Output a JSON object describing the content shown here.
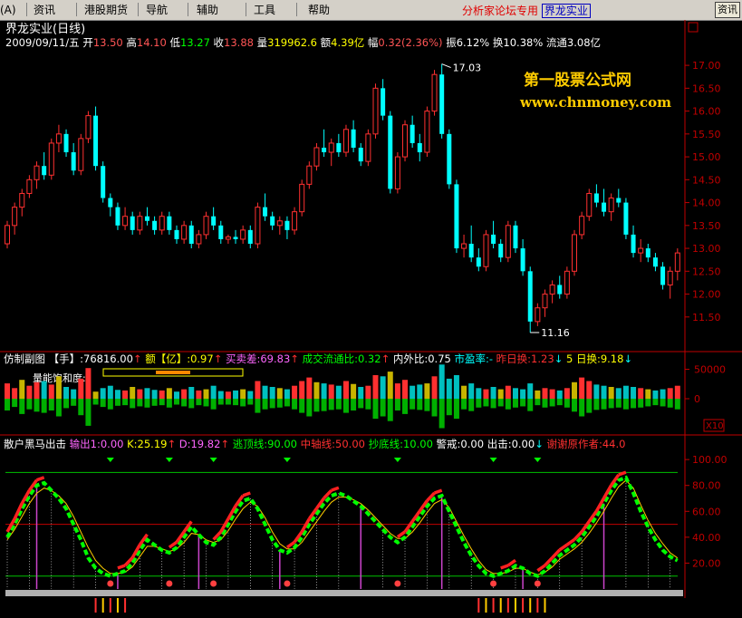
{
  "menu": {
    "items": [
      "(A)",
      "资讯",
      "港股期货",
      "导航",
      "辅助",
      "工具",
      "帮助"
    ],
    "announcement": "分析家论坛专用",
    "link": "界龙实业",
    "right_button": "资讯"
  },
  "main": {
    "title": "界龙实业(日线)",
    "date": "2009/09/11/五",
    "stats": [
      {
        "label": "开",
        "value": "13.50",
        "color": "#ff5555"
      },
      {
        "label": "高",
        "value": "14.10",
        "color": "#ff5555"
      },
      {
        "label": "低",
        "value": "13.27",
        "color": "#00ff00"
      },
      {
        "label": "收",
        "value": "13.88",
        "color": "#ff5555"
      },
      {
        "label": "量",
        "value": "319962.6",
        "color": "#ffff00"
      },
      {
        "label": "额",
        "value": "4.39亿",
        "color": "#ffff00"
      },
      {
        "label": "幅",
        "value": "0.32(2.36%)",
        "color": "#ff5555"
      },
      {
        "label": "振",
        "value": "6.12%",
        "color": "#ffffff"
      },
      {
        "label": "换",
        "value": "10.38%",
        "color": "#ffffff"
      },
      {
        "label": "流通",
        "value": "3.08亿",
        "color": "#ffffff"
      }
    ],
    "watermark1": "第一股票公式网",
    "watermark2": "www.chnmoney.com",
    "high_marker": "17.03",
    "low_marker": "11.16",
    "corner_box": "口"
  },
  "sub1": {
    "title": "仿制副图",
    "stats": [
      {
        "label": "【手】",
        "value": ":76816.00",
        "arrow": "↑",
        "color": "#ffffff",
        "arrow_color": "#ff3030"
      },
      {
        "label": "额【亿】",
        "value": ":0.97",
        "arrow": "↑",
        "color": "#ffff00",
        "arrow_color": "#ff3030"
      },
      {
        "label": "买卖差",
        "value": ":69.83",
        "arrow": "↑",
        "color": "#ff66ff",
        "arrow_color": "#ff3030"
      },
      {
        "label": "成交流通比",
        "value": ":0.32",
        "arrow": "↑",
        "color": "#00ff00",
        "arrow_color": "#ff3030"
      },
      {
        "label": "内外比",
        "value": ":0.75",
        "arrow": "",
        "color": "#ffffff",
        "arrow_color": "#ff3030"
      },
      {
        "label": "市盈率",
        "value": ":-",
        "arrow": "",
        "color": "#00ffff",
        "arrow_color": "#ff3030"
      },
      {
        "label": "昨日换",
        "value": ":1.23",
        "arrow": "↓",
        "color": "#ff3030",
        "arrow_color": "#00ffff"
      },
      {
        "label": "5 日换",
        "value": ":9.18",
        "arrow": "↓",
        "color": "#ffff00",
        "arrow_color": "#00ffff"
      }
    ],
    "label": "量能饱和度:",
    "x10": "X10"
  },
  "sub2": {
    "title": "散户黑马出击",
    "stats": [
      {
        "label": "输出",
        "value": "1:0.00",
        "arrow": "",
        "color": "#ff66ff",
        "arrow_color": "#ff3030"
      },
      {
        "label": "K",
        "value": ":25.19",
        "arrow": "↑",
        "color": "#ffff00",
        "arrow_color": "#ff3030"
      },
      {
        "label": "D",
        "value": ":19.82",
        "arrow": "↑",
        "color": "#ff66ff",
        "arrow_color": "#ff3030"
      },
      {
        "label": "逃顶线",
        "value": ":90.00",
        "arrow": "",
        "color": "#00ff00",
        "arrow_color": "#ff3030"
      },
      {
        "label": "中轴线",
        "value": ":50.00",
        "arrow": "",
        "color": "#ff3030",
        "arrow_color": "#ff3030"
      },
      {
        "label": "抄底线",
        "value": ":10.00",
        "arrow": "",
        "color": "#00ff00",
        "arrow_color": "#ff3030"
      },
      {
        "label": "警戒",
        "value": ":0.00",
        "arrow": "",
        "color": "#ffffff",
        "arrow_color": "#ff3030"
      },
      {
        "label": "出击",
        "value": ":0.00",
        "arrow": "↓",
        "color": "#ffffff",
        "arrow_color": "#00ffff"
      },
      {
        "label": "谢谢原作者",
        "value": ":44.0",
        "arrow": "",
        "color": "#ff3030",
        "arrow_color": "#ff3030"
      }
    ]
  },
  "chart_data": [
    {
      "type": "candlestick",
      "y_ticks": [
        "17.00",
        "16.50",
        "16.00",
        "15.50",
        "15.00",
        "14.50",
        "14.00",
        "13.50",
        "13.00",
        "12.50",
        "12.00",
        "11.50"
      ],
      "ylim": [
        11.1,
        17.2
      ],
      "colors": {
        "up": "#ff3030",
        "down": "#00ffff"
      },
      "ohlc": [
        [
          13.1,
          13.6,
          13.0,
          13.5
        ],
        [
          13.5,
          14.0,
          13.3,
          13.9
        ],
        [
          13.9,
          14.3,
          13.7,
          14.2
        ],
        [
          14.2,
          14.6,
          14.1,
          14.5
        ],
        [
          14.5,
          14.9,
          14.3,
          14.8
        ],
        [
          14.8,
          15.1,
          14.5,
          14.6
        ],
        [
          14.6,
          15.4,
          14.5,
          15.3
        ],
        [
          15.3,
          15.7,
          15.1,
          15.5
        ],
        [
          15.5,
          15.6,
          15.0,
          15.1
        ],
        [
          15.1,
          15.3,
          14.6,
          14.7
        ],
        [
          14.7,
          15.5,
          14.6,
          15.4
        ],
        [
          15.4,
          16.0,
          15.3,
          15.9
        ],
        [
          15.9,
          16.1,
          14.7,
          14.8
        ],
        [
          14.8,
          14.9,
          14.0,
          14.1
        ],
        [
          14.1,
          14.2,
          13.7,
          13.9
        ],
        [
          13.9,
          14.0,
          13.4,
          13.5
        ],
        [
          13.5,
          13.9,
          13.4,
          13.7
        ],
        [
          13.7,
          13.8,
          13.3,
          13.4
        ],
        [
          13.4,
          13.8,
          13.3,
          13.7
        ],
        [
          13.7,
          13.9,
          13.5,
          13.6
        ],
        [
          13.6,
          13.7,
          13.3,
          13.4
        ],
        [
          13.4,
          13.8,
          13.3,
          13.7
        ],
        [
          13.7,
          13.8,
          13.3,
          13.4
        ],
        [
          13.4,
          13.5,
          13.1,
          13.2
        ],
        [
          13.2,
          13.6,
          13.1,
          13.5
        ],
        [
          13.5,
          13.6,
          13.0,
          13.1
        ],
        [
          13.1,
          13.4,
          13.0,
          13.3
        ],
        [
          13.3,
          13.8,
          13.2,
          13.7
        ],
        [
          13.7,
          13.9,
          13.4,
          13.5
        ],
        [
          13.5,
          13.6,
          13.1,
          13.2
        ],
        [
          13.2,
          13.3,
          13.1,
          13.25
        ],
        [
          13.25,
          13.4,
          13.1,
          13.2
        ],
        [
          13.2,
          13.5,
          13.1,
          13.4
        ],
        [
          13.4,
          13.5,
          13.0,
          13.1
        ],
        [
          13.1,
          14.0,
          13.0,
          13.9
        ],
        [
          13.9,
          14.2,
          13.6,
          13.7
        ],
        [
          13.7,
          13.8,
          13.4,
          13.5
        ],
        [
          13.5,
          13.7,
          13.3,
          13.6
        ],
        [
          13.6,
          13.7,
          13.2,
          13.4
        ],
        [
          13.4,
          13.9,
          13.3,
          13.8
        ],
        [
          13.8,
          14.5,
          13.7,
          14.4
        ],
        [
          14.4,
          14.9,
          14.3,
          14.8
        ],
        [
          14.8,
          15.3,
          14.7,
          15.2
        ],
        [
          15.2,
          15.6,
          15.0,
          15.1
        ],
        [
          15.1,
          15.4,
          14.8,
          15.3
        ],
        [
          15.3,
          15.5,
          15.0,
          15.1
        ],
        [
          15.1,
          15.7,
          15.0,
          15.6
        ],
        [
          15.6,
          15.8,
          15.1,
          15.2
        ],
        [
          15.2,
          15.3,
          14.8,
          14.9
        ],
        [
          14.9,
          15.6,
          14.8,
          15.5
        ],
        [
          15.5,
          16.6,
          15.4,
          16.5
        ],
        [
          16.5,
          16.7,
          15.8,
          15.9
        ],
        [
          15.9,
          16.0,
          14.2,
          14.3
        ],
        [
          14.3,
          15.1,
          14.2,
          15.0
        ],
        [
          15.0,
          15.8,
          14.9,
          15.7
        ],
        [
          15.7,
          15.9,
          15.2,
          15.3
        ],
        [
          15.3,
          15.5,
          14.9,
          15.1
        ],
        [
          15.1,
          16.1,
          15.0,
          16.0
        ],
        [
          16.0,
          16.9,
          15.9,
          16.8
        ],
        [
          16.8,
          17.03,
          15.4,
          15.5
        ],
        [
          15.5,
          15.6,
          14.3,
          14.4
        ],
        [
          14.4,
          14.5,
          12.9,
          13.0
        ],
        [
          13.0,
          13.3,
          12.8,
          13.1
        ],
        [
          13.1,
          13.5,
          12.7,
          12.8
        ],
        [
          12.8,
          13.0,
          12.5,
          12.6
        ],
        [
          12.6,
          13.4,
          12.5,
          13.3
        ],
        [
          13.3,
          13.6,
          13.0,
          13.1
        ],
        [
          13.1,
          13.2,
          12.7,
          12.8
        ],
        [
          12.8,
          13.6,
          12.7,
          13.5
        ],
        [
          13.5,
          13.6,
          12.9,
          13.0
        ],
        [
          13.0,
          13.2,
          12.4,
          12.5
        ],
        [
          12.5,
          12.6,
          11.16,
          11.4
        ],
        [
          11.4,
          11.8,
          11.3,
          11.7
        ],
        [
          11.7,
          12.1,
          11.5,
          12.0
        ],
        [
          12.0,
          12.3,
          11.8,
          12.2
        ],
        [
          12.2,
          12.4,
          11.9,
          12.0
        ],
        [
          12.0,
          12.6,
          11.9,
          12.5
        ],
        [
          12.5,
          13.4,
          12.4,
          13.3
        ],
        [
          13.3,
          13.8,
          13.2,
          13.7
        ],
        [
          13.7,
          14.3,
          13.6,
          14.2
        ],
        [
          14.2,
          14.4,
          13.9,
          14.0
        ],
        [
          14.0,
          14.3,
          13.7,
          13.8
        ],
        [
          13.8,
          14.2,
          13.6,
          14.1
        ],
        [
          14.1,
          14.3,
          13.9,
          14.0
        ],
        [
          14.0,
          14.1,
          13.2,
          13.3
        ],
        [
          13.3,
          13.5,
          12.8,
          12.9
        ],
        [
          12.9,
          13.2,
          12.7,
          13.0
        ],
        [
          13.0,
          13.1,
          12.7,
          12.8
        ],
        [
          12.8,
          12.9,
          12.5,
          12.6
        ],
        [
          12.6,
          12.7,
          12.1,
          12.2
        ],
        [
          12.2,
          12.6,
          11.9,
          12.5
        ],
        [
          12.5,
          13.0,
          12.3,
          12.9
        ]
      ]
    },
    {
      "type": "bar",
      "y_ticks": [
        "50000",
        "0"
      ],
      "ylim": [
        -60000,
        60000
      ],
      "series": [
        {
          "values": [
            26000,
            18000,
            32000,
            22000,
            28000,
            30000,
            24000,
            38000,
            20000,
            16000,
            34000,
            52000,
            12000,
            18000,
            22000,
            15000,
            14000,
            20000,
            16000,
            18000,
            15000,
            14000,
            18000,
            12000,
            16000,
            20000,
            14000,
            16000,
            22000,
            13000,
            12000,
            14000,
            16000,
            13000,
            30000,
            22000,
            20000,
            18000,
            16000,
            22000,
            30000,
            36000,
            28000,
            26000,
            24000,
            22000,
            30000,
            25000,
            20000,
            22000,
            40000,
            38000,
            46000,
            26000,
            32000,
            22000,
            24000,
            26000,
            38000,
            58000,
            34000,
            40000,
            22000,
            26000,
            18000,
            16000,
            20000,
            16000,
            22000,
            18000,
            16000,
            26000,
            14000,
            18000,
            16000,
            14000,
            18000,
            28000,
            36000,
            30000,
            24000,
            22000,
            20000,
            18000,
            22000,
            20000,
            18000,
            16000,
            14000,
            16000,
            18000,
            22000
          ]
        },
        {
          "values": [
            -20000,
            -14000,
            -26000,
            -18000,
            -22000,
            -24000,
            -20000,
            -30000,
            -16000,
            -12000,
            -28000,
            -46000,
            -10000,
            -14000,
            -18000,
            -12000,
            -11000,
            -16000,
            -13000,
            -15000,
            -12000,
            -11000,
            -15000,
            -10000,
            -13000,
            -16000,
            -11000,
            -13000,
            -18000,
            -10000,
            -10000,
            -11000,
            -13000,
            -10000,
            -24000,
            -18000,
            -16000,
            -15000,
            -13000,
            -18000,
            -24000,
            -30000,
            -22000,
            -21000,
            -19000,
            -18000,
            -24000,
            -20000,
            -16000,
            -18000,
            -34000,
            -30000,
            -38000,
            -20000,
            -26000,
            -18000,
            -19000,
            -21000,
            -30000,
            -50000,
            -28000,
            -34000,
            -18000,
            -21000,
            -15000,
            -13000,
            -16000,
            -13000,
            -18000,
            -15000,
            -13000,
            -21000,
            -11000,
            -15000,
            -13000,
            -11000,
            -15000,
            -22000,
            -30000,
            -24000,
            -19000,
            -18000,
            -16000,
            -15000,
            -18000,
            -16000,
            -15000,
            -13000,
            -11000,
            -13000,
            -15000,
            -18000
          ]
        }
      ]
    },
    {
      "type": "line",
      "y_ticks": [
        "100.00",
        "80.00",
        "60.00",
        "40.00",
        "20.00"
      ],
      "ylim": [
        0,
        105
      ],
      "hlines": [
        90,
        50,
        10
      ],
      "series": [
        {
          "name": "K",
          "values": [
            40,
            50,
            62,
            72,
            80,
            82,
            76,
            70,
            62,
            50,
            38,
            24,
            16,
            12,
            10,
            12,
            14,
            20,
            30,
            38,
            34,
            30,
            28,
            32,
            40,
            48,
            42,
            36,
            34,
            40,
            50,
            60,
            68,
            70,
            62,
            50,
            38,
            30,
            28,
            32,
            40,
            50,
            58,
            66,
            72,
            74,
            72,
            68,
            64,
            58,
            52,
            46,
            40,
            36,
            40,
            48,
            56,
            64,
            70,
            72,
            60,
            48,
            36,
            26,
            18,
            12,
            10,
            12,
            14,
            18,
            16,
            12,
            10,
            14,
            20,
            26,
            30,
            34,
            40,
            48,
            56,
            66,
            76,
            84,
            86,
            74,
            60,
            48,
            38,
            30,
            25,
            22
          ]
        },
        {
          "name": "D",
          "values": [
            38,
            46,
            56,
            66,
            74,
            78,
            76,
            72,
            66,
            56,
            44,
            32,
            22,
            16,
            12,
            12,
            13,
            17,
            25,
            33,
            33,
            31,
            29,
            31,
            36,
            43,
            42,
            38,
            36,
            38,
            45,
            54,
            62,
            67,
            64,
            55,
            44,
            35,
            31,
            31,
            36,
            44,
            52,
            60,
            67,
            71,
            71,
            69,
            66,
            61,
            55,
            49,
            43,
            39,
            39,
            44,
            51,
            59,
            66,
            69,
            63,
            52,
            41,
            31,
            22,
            15,
            12,
            12,
            13,
            16,
            16,
            13,
            11,
            13,
            17,
            23,
            27,
            31,
            36,
            43,
            51,
            60,
            70,
            79,
            84,
            78,
            65,
            53,
            43,
            35,
            28,
            24
          ]
        }
      ]
    }
  ]
}
